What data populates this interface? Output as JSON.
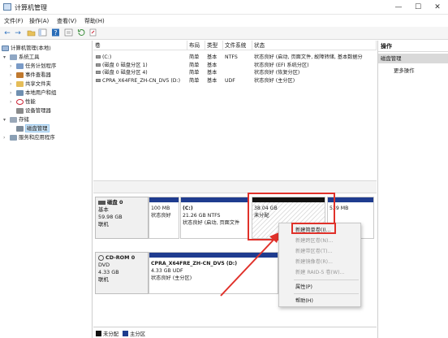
{
  "window": {
    "title": "计算机管理",
    "controls": {
      "minimize": "—",
      "maximize": "☐",
      "close": "✕"
    }
  },
  "menubar": [
    "文件(F)",
    "操作(A)",
    "查看(V)",
    "帮助(H)"
  ],
  "toolbar": {
    "back": "←",
    "forward": "→"
  },
  "tree": {
    "root": "计算机管理(本地)",
    "system_tools": "系统工具",
    "task_scheduler": "任务计划程序",
    "event_viewer": "事件查看器",
    "shared_folders": "共享文件夹",
    "local_users": "本地用户和组",
    "performance": "性能",
    "device_manager": "设备管理器",
    "storage": "存储",
    "disk_management": "磁盘管理",
    "services": "服务和应用程序"
  },
  "volume_table": {
    "headers": [
      "卷",
      "布局",
      "类型",
      "文件系统",
      "状态"
    ],
    "rows": [
      {
        "volume": "(C:)",
        "layout": "简单",
        "type": "基本",
        "fs": "NTFS",
        "status": "状态良好 (启动, 页面文件, 故障转储, 基本数据分"
      },
      {
        "volume": "(磁盘 0 磁盘分区 1)",
        "layout": "简单",
        "type": "基本",
        "fs": "",
        "status": "状态良好 (EFI 系统分区)"
      },
      {
        "volume": "(磁盘 0 磁盘分区 4)",
        "layout": "简单",
        "type": "基本",
        "fs": "",
        "status": "状态良好 (恢复分区)"
      },
      {
        "volume": "CPRA_X64FRE_ZH-CN_DV5 (D:)",
        "layout": "简单",
        "type": "基本",
        "fs": "UDF",
        "status": "状态良好 (主分区)"
      }
    ]
  },
  "disk0": {
    "name": "磁盘 0",
    "type": "基本",
    "size": "59.98 GB",
    "status": "联机",
    "partitions": [
      {
        "label": "",
        "size": "100 MB",
        "status": "状态良好"
      },
      {
        "label": "(C:)",
        "size": "21.26 GB NTFS",
        "status": "状态良好 (启动, 页面文件"
      },
      {
        "label": "",
        "size": "38.04 GB",
        "status": "未分配"
      },
      {
        "label": "",
        "size": "539 MB",
        "status": ""
      }
    ]
  },
  "cdrom0": {
    "name": "CD-ROM 0",
    "type": "DVD",
    "size": "4.33 GB",
    "status": "联机",
    "partition": {
      "label": "CPRA_X64FRE_ZH-CN_DV5 (D:)",
      "size": "4.33 GB UDF",
      "status": "状态良好 (主分区)"
    }
  },
  "legend": {
    "unallocated": "未分配",
    "primary": "主分区"
  },
  "actions": {
    "header": "操作",
    "selected": "磁盘管理",
    "more": "更多操作"
  },
  "context_menu": [
    {
      "label": "新建简单卷(I)...",
      "disabled": false
    },
    {
      "label": "新建跨区卷(N)...",
      "disabled": true
    },
    {
      "label": "新建带区卷(T)...",
      "disabled": true
    },
    {
      "label": "新建镜像卷(R)...",
      "disabled": true
    },
    {
      "label": "新建 RAID-5 卷(W)...",
      "disabled": true
    },
    {
      "label": "属性(P)",
      "disabled": false
    },
    {
      "label": "帮助(H)",
      "disabled": false
    }
  ],
  "colors": {
    "primary_partition": "#1f3c8f",
    "unallocated": "#111111",
    "highlight": "#e0312a"
  }
}
